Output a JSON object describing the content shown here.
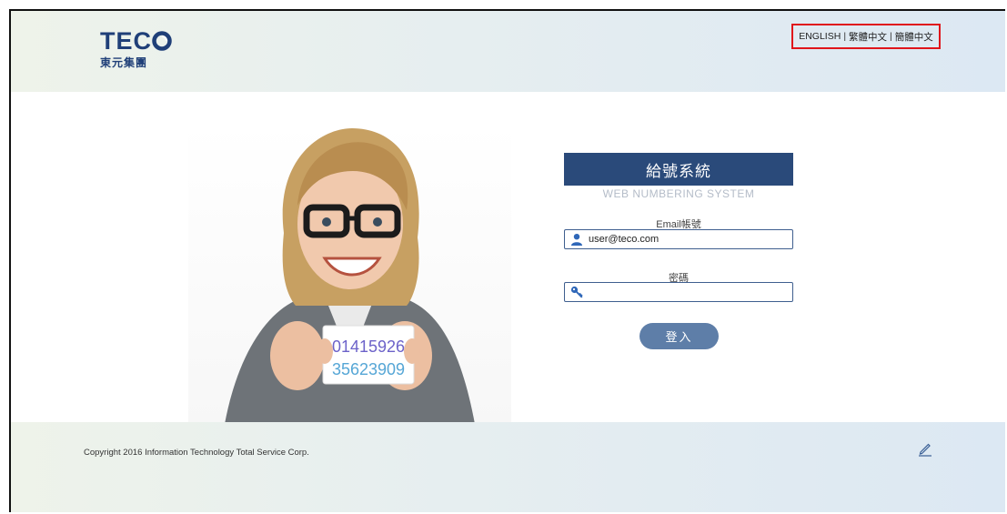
{
  "header": {
    "logo_text": "TECO",
    "logo_subtext": "東元集團",
    "languages": [
      "ENGLISH",
      "繁體中文",
      "簡體中文"
    ],
    "lang_separator": "|"
  },
  "hero": {
    "card_line1": "01415926",
    "card_line2": "35623909"
  },
  "login": {
    "title": "給號系統",
    "subtitle": "WEB NUMBERING SYSTEM",
    "email_label": "Email帳號",
    "email_value": "user@teco.com",
    "password_label": "密碼",
    "password_value": "",
    "submit_label": "登入",
    "accent_color": "#2a4a7a"
  },
  "footer": {
    "copyright": "Copyright 2016 Information Technology Total Service Corp.",
    "edit_icon": "pencil-icon"
  }
}
